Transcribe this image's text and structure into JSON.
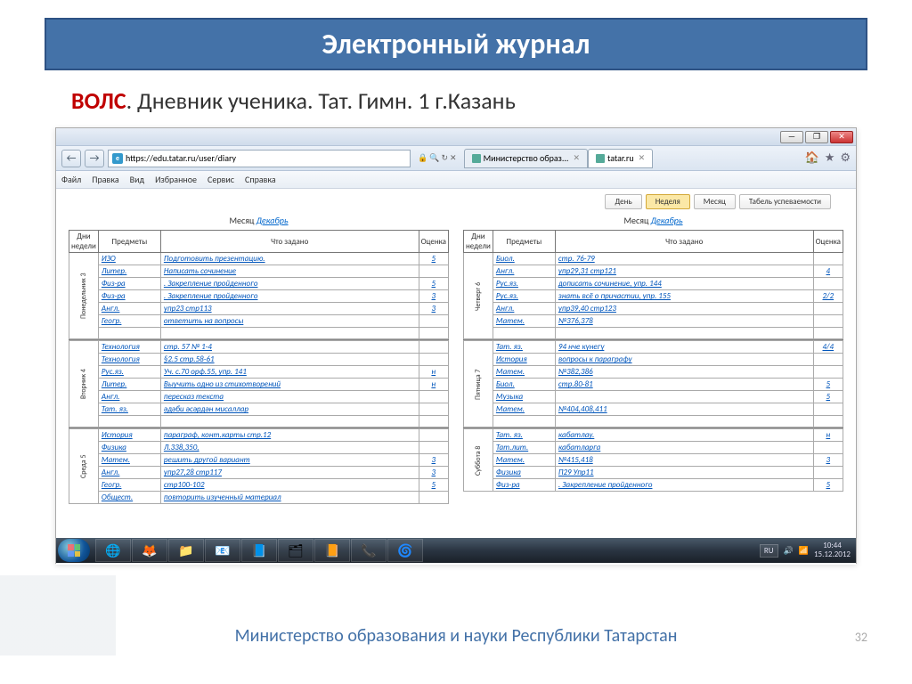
{
  "slide": {
    "title": "Электронный журнал",
    "subtitle_red": "ВОЛС",
    "subtitle_rest": ".  Дневник ученика. Тат. Гимн. 1  г.Казань",
    "footer": "Министерство образования и науки Республики Татарстан",
    "pagenum": "32"
  },
  "browser": {
    "url": "https://edu.tatar.ru/user/diary",
    "search_icons": "🔒 🔍 ↻ ✕",
    "tabs": [
      {
        "label": "Министерство образ...",
        "active": false
      },
      {
        "label": "tatar.ru",
        "active": true
      }
    ],
    "menu": [
      "Файл",
      "Правка",
      "Вид",
      "Избранное",
      "Сервис",
      "Справка"
    ],
    "tools": [
      "🏠",
      "★",
      "⚙"
    ]
  },
  "diary": {
    "controls": [
      {
        "label": "День",
        "active": false
      },
      {
        "label": "Неделя",
        "active": true
      },
      {
        "label": "Месяц",
        "active": false
      },
      {
        "label": "Табель успеваемости",
        "active": false
      }
    ],
    "month_label": "Месяц",
    "month_value": "Декабрь",
    "headers": {
      "day": "Дни недели",
      "subject": "Предметы",
      "task": "Что задано",
      "grade": "Оценка"
    },
    "left": [
      {
        "day": "Понедельник 3",
        "rows": [
          {
            "s": "ИЗО",
            "t": "Подготовить презентацию.",
            "g": "5"
          },
          {
            "s": "Литер.",
            "t": "Написать сочинение",
            "g": ""
          },
          {
            "s": "Физ-ра",
            "t": ". Закрепление пройденного",
            "g": "5"
          },
          {
            "s": "Физ-ра",
            "t": ". Закрепление пройденного",
            "g": "3"
          },
          {
            "s": "Англ.",
            "t": "упр23 стр113",
            "g": "3"
          },
          {
            "s": "Геогр.",
            "t": "ответить на вопросы",
            "g": ""
          },
          {
            "s": "",
            "t": "",
            "g": ""
          }
        ]
      },
      {
        "day": "Вторник 4",
        "rows": [
          {
            "s": "Технология",
            "t": "стр. 57 № 1-4",
            "g": ""
          },
          {
            "s": "Технология",
            "t": "§2.5 стр.58-61",
            "g": ""
          },
          {
            "s": "Рус.яз.",
            "t": "Уч. с.70 орф.55, упр. 141",
            "g": "н"
          },
          {
            "s": "Литер.",
            "t": "Выучить одно из стихотворений",
            "g": "н"
          },
          {
            "s": "Англ.",
            "t": "пересказ текста",
            "g": ""
          },
          {
            "s": "Тат. яз.",
            "t": "әдәби әсәрдән мисаллар",
            "g": ""
          },
          {
            "s": "",
            "t": "",
            "g": ""
          }
        ]
      },
      {
        "day": "Среда 5",
        "rows": [
          {
            "s": "История",
            "t": "параграф, конт.карты стр.12",
            "g": ""
          },
          {
            "s": "Физика",
            "t": "Л.338,350,",
            "g": ""
          },
          {
            "s": "Матем.",
            "t": "решить другой вариант",
            "g": "3"
          },
          {
            "s": "Англ.",
            "t": "упр27,28 стр117",
            "g": "3"
          },
          {
            "s": "Геогр.",
            "t": "стр100-102",
            "g": "5"
          },
          {
            "s": "Общест.",
            "t": "повторить изученный материал",
            "g": ""
          }
        ]
      }
    ],
    "right": [
      {
        "day": "Четверг 6",
        "rows": [
          {
            "s": "Биол.",
            "t": "стр. 76-79",
            "g": ""
          },
          {
            "s": "Англ.",
            "t": "упр29,31 стр121",
            "g": "4"
          },
          {
            "s": "Рус.яз.",
            "t": "дописать сочинение, упр. 144",
            "g": ""
          },
          {
            "s": "Рус.яз.",
            "t": "знать всё о причастии, упр. 155",
            "g": "2/2"
          },
          {
            "s": "Англ.",
            "t": "упр39,40 стр123",
            "g": ""
          },
          {
            "s": "Матем.",
            "t": "№376,378",
            "g": ""
          },
          {
            "s": "",
            "t": "",
            "g": ""
          }
        ]
      },
      {
        "day": "Пятница 7",
        "rows": [
          {
            "s": "Тат. яз.",
            "t": "94 нче күнегү",
            "g": "4/4"
          },
          {
            "s": "История",
            "t": "вопросы к параграфу",
            "g": ""
          },
          {
            "s": "Матем.",
            "t": "№382,386",
            "g": ""
          },
          {
            "s": "Биол.",
            "t": "стр.80-81",
            "g": "5"
          },
          {
            "s": "Музыка",
            "t": "",
            "g": "5"
          },
          {
            "s": "Матем.",
            "t": "№404,408,411",
            "g": ""
          },
          {
            "s": "",
            "t": "",
            "g": ""
          }
        ]
      },
      {
        "day": "Суббота 8",
        "rows": [
          {
            "s": "Тат. яз.",
            "t": "кабатлау.",
            "g": "н"
          },
          {
            "s": "Тат.лит.",
            "t": "кабатларга",
            "g": ""
          },
          {
            "s": "Матем.",
            "t": "№415,418",
            "g": "3"
          },
          {
            "s": "Физика",
            "t": "П29 Упр11",
            "g": ""
          },
          {
            "s": "Физ-ра",
            "t": ". Закрепление пройденного",
            "g": "5"
          }
        ]
      }
    ]
  },
  "taskbar": {
    "icons": [
      "chrome",
      "firefox",
      "explorer",
      "outlook",
      "word",
      "folder",
      "powerpoint",
      "skype",
      "ie"
    ],
    "lang": "RU",
    "time": "10:44",
    "date": "15.12.2012"
  }
}
